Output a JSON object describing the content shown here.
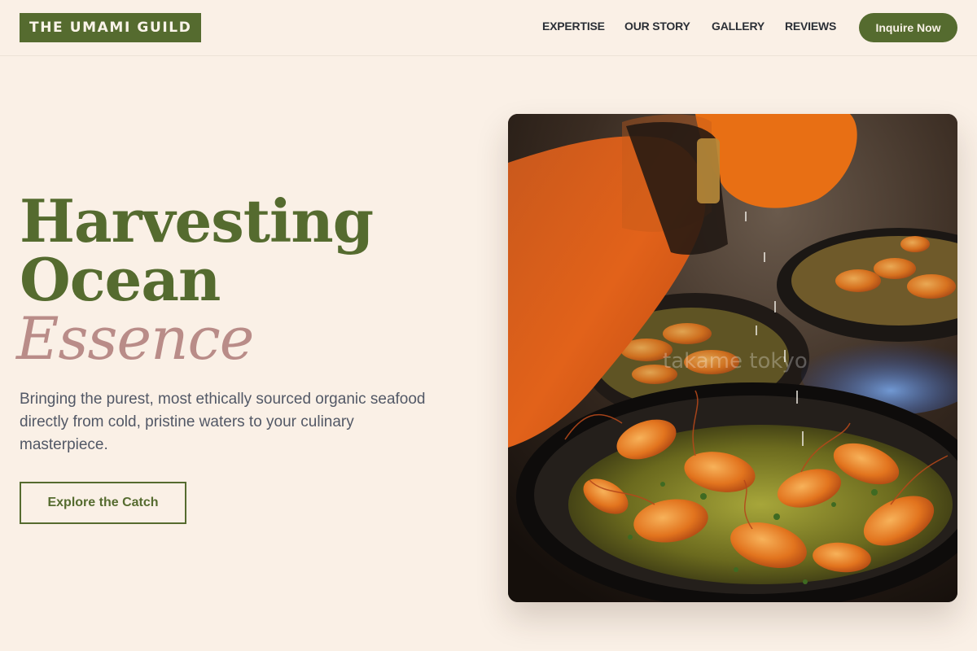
{
  "header": {
    "logo": "THE UMAMI GUILD",
    "nav": [
      {
        "label": "EXPERTISE"
      },
      {
        "label": "OUR STORY"
      },
      {
        "label": "GALLERY"
      },
      {
        "label": "REVIEWS"
      }
    ],
    "cta_label": "Inquire Now"
  },
  "hero": {
    "title_line1": "Harvesting",
    "title_line2": "Ocean",
    "title_accent": "Essence",
    "description": "Bringing the purest, most ethically sourced organic seafood directly from cold, pristine waters to your culinary masterpiece.",
    "button_label": "Explore the Catch",
    "photo_watermark": "takame tokyo"
  },
  "colors": {
    "background": "#faf0e6",
    "brand_green": "#556b2f",
    "accent_rose": "#b98c88"
  }
}
